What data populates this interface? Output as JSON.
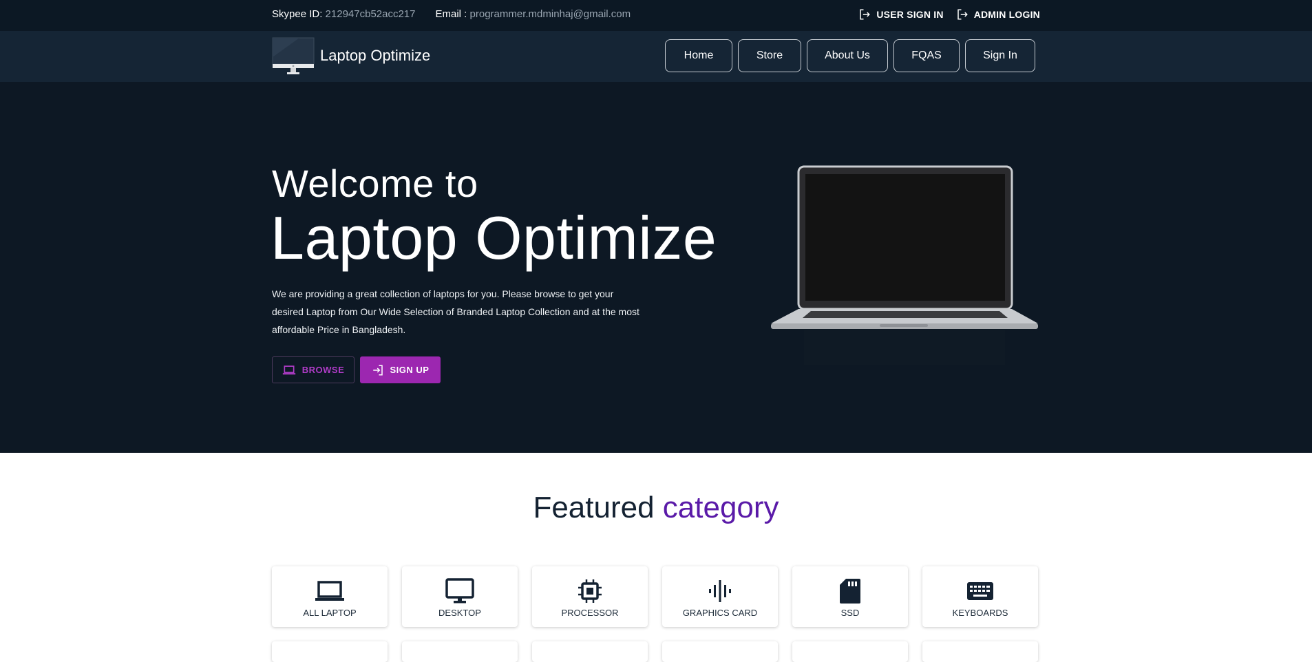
{
  "topbar": {
    "skype_label": "Skypee ID:",
    "skype_value": "212947cb52acc217",
    "email_label": "Email :",
    "email_value": "programmer.mdminhaj@gmail.com",
    "user_sign_in": "USER SIGN IN",
    "admin_login": "ADMIN LOGIN"
  },
  "navbar": {
    "brand": "Laptop Optimize",
    "links": [
      "Home",
      "Store",
      "About Us",
      "FQAS",
      "Sign In"
    ]
  },
  "hero": {
    "welcome": "Welcome to",
    "title": "Laptop Optimize",
    "description": "We are providing a great collection of laptops for you. Please browse to get your desired Laptop from Our Wide Selection of Branded Laptop Collection and at the most affordable Price in Bangladesh.",
    "browse_label": "BROWSE",
    "signup_label": "SIGN UP"
  },
  "featured": {
    "title_main": "Featured",
    "title_accent": "category"
  },
  "categories": [
    {
      "label": "ALL LAPTOP",
      "icon": "laptop-icon"
    },
    {
      "label": "DESKTOP",
      "icon": "desktop-icon"
    },
    {
      "label": "PROCESSOR",
      "icon": "processor-icon"
    },
    {
      "label": "GRAPHICS CARD",
      "icon": "graphics-card-icon"
    },
    {
      "label": "SSD",
      "icon": "ssd-icon"
    },
    {
      "label": "KEYBOARDS",
      "icon": "keyboard-icon"
    }
  ],
  "colors": {
    "topbar_bg": "#0c1824",
    "navbar_bg": "#152535",
    "hero_bg": "#0d1824",
    "accent_purple": "#9c27b0",
    "heading_accent": "#5a1aa8"
  }
}
